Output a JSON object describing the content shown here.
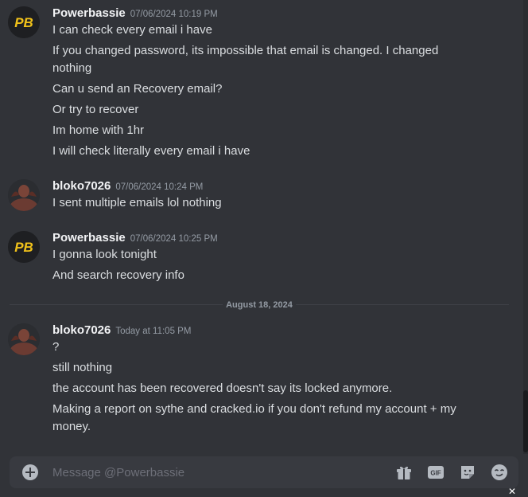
{
  "messages": [
    {
      "author": "Powerbassie",
      "avatar": "pb-logo-avatar",
      "timestamp": "07/06/2024 10:19 PM",
      "lines": [
        "I can check every email i have",
        "If you changed password, its impossible that email is changed. I changed nothing",
        "Can u send an Recovery email?",
        "Or try to recover",
        "Im home with 1hr",
        "I will check literally every email i have"
      ]
    },
    {
      "author": "bloko7026",
      "avatar": "user-photo-avatar",
      "timestamp": "07/06/2024 10:24 PM",
      "lines": [
        "I sent multiple emails lol nothing"
      ]
    },
    {
      "author": "Powerbassie",
      "avatar": "pb-logo-avatar",
      "timestamp": "07/06/2024 10:25 PM",
      "lines": [
        "I gonna look tonight",
        "And search recovery info"
      ]
    },
    {
      "author": "bloko7026",
      "avatar": "user-photo-avatar",
      "timestamp": "Today at 11:05 PM",
      "lines": [
        "?",
        "still nothing",
        "the account has been recovered doesn't say its locked anymore.",
        "Making a report on sythe and cracked.io if you don't refund my account + my money."
      ]
    }
  ],
  "date_divider": "August 18, 2024",
  "composer": {
    "placeholder": "Message @Powerbassie",
    "icons": [
      "plus-circle-icon",
      "gift-icon",
      "gif-icon",
      "sticker-icon",
      "emoji-icon"
    ],
    "gif_label": "GIF"
  },
  "colors": {
    "background": "#313338",
    "composer": "#383a40",
    "text": "#dbdee1",
    "muted": "#949ba4",
    "pb_logo": "#f0c11a"
  }
}
